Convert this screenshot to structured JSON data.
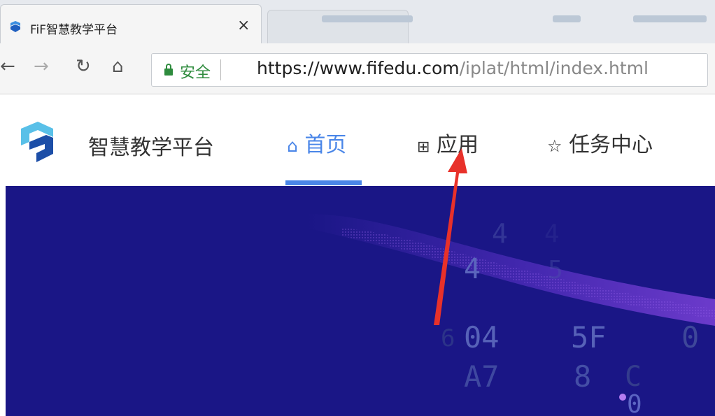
{
  "browser": {
    "tab_title": "FiF智慧教学平台",
    "tab_close": "×",
    "url_host": "https://www.fifedu.com",
    "url_path": "/iplat/html/index.html",
    "secure_label": "安全",
    "icons": [
      "back-icon",
      "forward-icon",
      "reload-icon",
      "home-icon",
      "lock-icon"
    ]
  },
  "site": {
    "name": "智慧教学平台",
    "nav": [
      {
        "label": "首页",
        "icon": "home-icon",
        "active": true
      },
      {
        "label": "应用",
        "icon": "apps-grid-icon",
        "active": false
      },
      {
        "label": "任务中心",
        "icon": "star-icon",
        "active": false
      }
    ]
  },
  "hero": {
    "glyphs": [
      "4",
      "4",
      "5",
      "4",
      "04",
      "5F",
      "0",
      "A7",
      "8",
      "C",
      "0",
      "6"
    ]
  },
  "colors": {
    "accent": "#4a86e8",
    "hero_bg": "#1a1686",
    "secure_green": "#2e8b3d",
    "annotation_red": "#e8312a"
  }
}
